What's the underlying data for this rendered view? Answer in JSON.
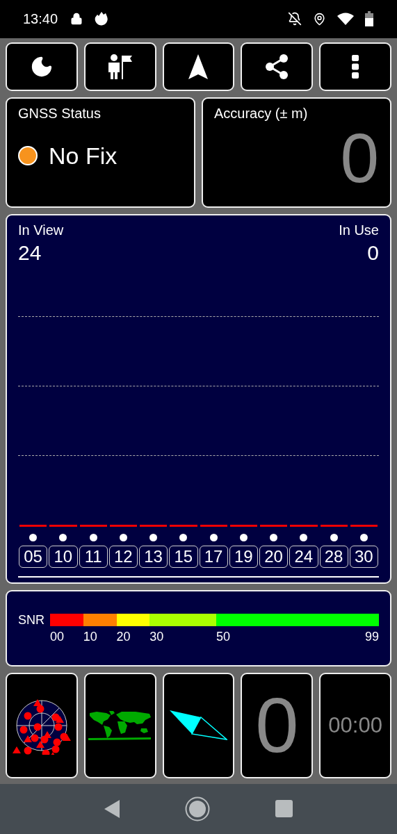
{
  "status_bar": {
    "time": "13:40"
  },
  "toolbar": {
    "buttons": [
      {
        "kind": "night"
      },
      {
        "kind": "goal"
      },
      {
        "kind": "navigate"
      },
      {
        "kind": "share"
      },
      {
        "kind": "more"
      }
    ]
  },
  "gnss_status": {
    "title": "GNSS Status",
    "value": "No Fix"
  },
  "accuracy": {
    "title": "Accuracy (± m)",
    "value": "0"
  },
  "satellites": {
    "in_view_label": "In View",
    "in_view": "24",
    "in_use_label": "In Use",
    "in_use": "0",
    "ids": [
      "05",
      "10",
      "11",
      "12",
      "13",
      "15",
      "17",
      "19",
      "20",
      "24",
      "28",
      "30"
    ]
  },
  "snr": {
    "label": "SNR",
    "segments": [
      {
        "label": "00",
        "color": "#ff0000"
      },
      {
        "label": "10",
        "color": "#ff8000"
      },
      {
        "label": "20",
        "color": "#ffff00"
      },
      {
        "label": "30",
        "color": "#aaff00"
      },
      {
        "label": "50",
        "color": "#00ff00"
      }
    ],
    "end_label": "99"
  },
  "tiles": [
    {
      "kind": "radar"
    },
    {
      "kind": "map"
    },
    {
      "kind": "compass"
    },
    {
      "kind": "number",
      "text": "0"
    },
    {
      "kind": "clock",
      "text": "00:00"
    }
  ]
}
